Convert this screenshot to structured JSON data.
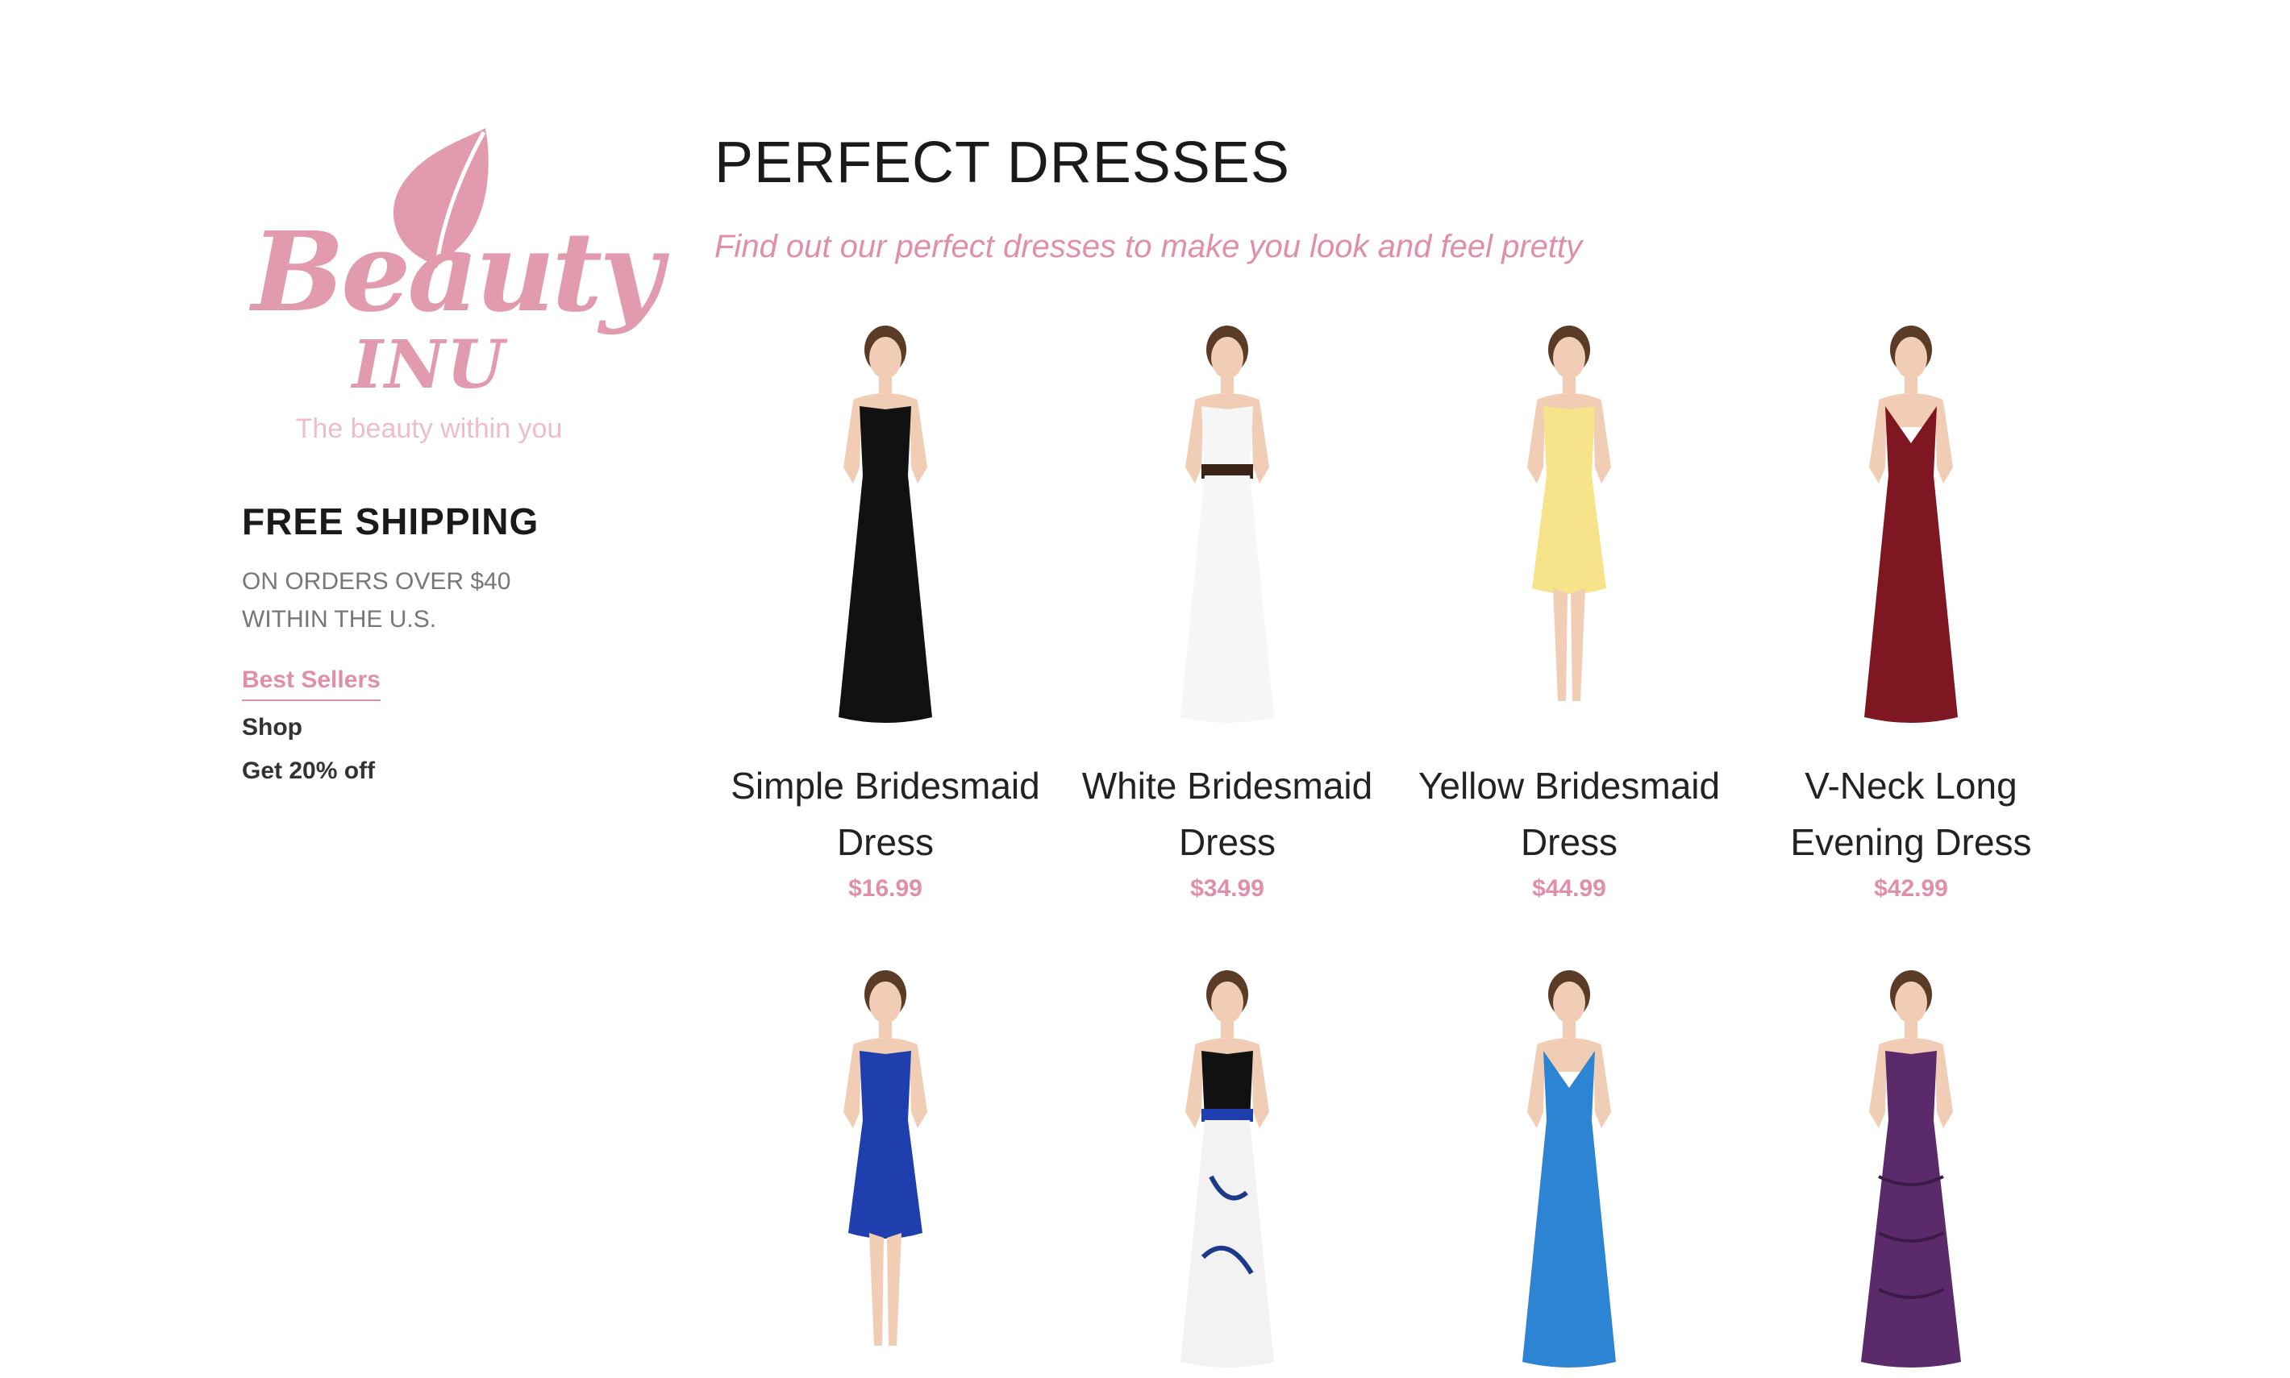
{
  "brand": {
    "name": "Beauty",
    "sub": "INU",
    "tagline": "The beauty within you",
    "accent": "#e29aae"
  },
  "shipping": {
    "title": "FREE SHIPPING",
    "desc": "ON ORDERS OVER $40 WITHIN THE U.S."
  },
  "nav": {
    "items": [
      {
        "label": "Best Sellers"
      },
      {
        "label": "Shop"
      },
      {
        "label": "Get 20% off"
      }
    ]
  },
  "main": {
    "title": "PERFECT DRESSES",
    "subtitle": "Find out our perfect dresses to make you look and feel pretty"
  },
  "products": [
    {
      "name": "Simple Bridesmaid Dress",
      "price": "$16.99",
      "dress_color": "#111111",
      "style": "one-shoulder-long"
    },
    {
      "name": "White Bridesmaid Dress",
      "price": "$34.99",
      "dress_color": "#f6f6f6",
      "style": "sash-long"
    },
    {
      "name": "Yellow Bridesmaid Dress",
      "price": "$44.99",
      "dress_color": "#f6e38a",
      "style": "short"
    },
    {
      "name": "V-Neck Long Evening Dress",
      "price": "$42.99",
      "dress_color": "#7e1722",
      "style": "vneck-long"
    },
    {
      "name": "",
      "price": "",
      "dress_color": "#1f3fae",
      "style": "short"
    },
    {
      "name": "",
      "price": "",
      "dress_color": "#f2f2f2",
      "style": "black-top-long"
    },
    {
      "name": "",
      "price": "",
      "dress_color": "#2d84d2",
      "style": "vneck-long"
    },
    {
      "name": "",
      "price": "",
      "dress_color": "#5a2a6a",
      "style": "ruffle-long"
    }
  ]
}
